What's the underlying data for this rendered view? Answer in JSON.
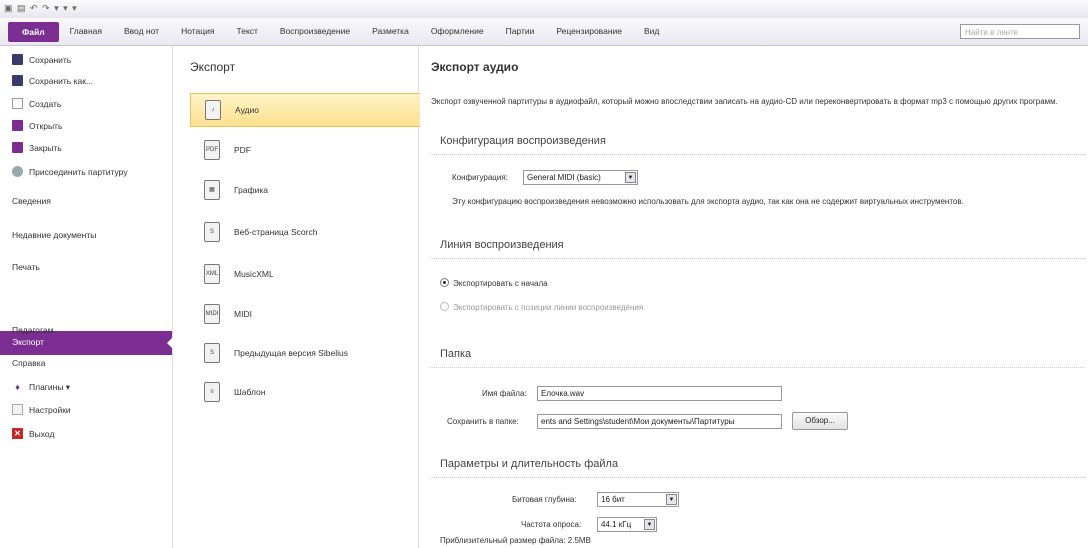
{
  "title_bar": {
    "quick_access": "▣ ▤ ↶ ↷ ▾ ▾ ▾"
  },
  "ribbon": {
    "tabs": [
      "Файл",
      "Главная",
      "Ввод нот",
      "Нотация",
      "Текст",
      "Воспроизведение",
      "Разметка",
      "Оформление",
      "Партии",
      "Рецензирование",
      "Вид"
    ],
    "search_placeholder": "Найти в ленте"
  },
  "sidebar": {
    "commands": [
      {
        "label": "Сохранить",
        "icon": "save-icon"
      },
      {
        "label": "Сохранить как...",
        "icon": "save-as-icon"
      },
      {
        "label": "Создать",
        "icon": "new-document-icon"
      },
      {
        "label": "Открыть",
        "icon": "open-folder-icon"
      },
      {
        "label": "Закрыть",
        "icon": "close-folder-icon"
      },
      {
        "label": "Присоединить партитуру",
        "icon": "attach-score-icon"
      }
    ],
    "sections": [
      "Сведения",
      "Недавние документы",
      "Печать",
      "Экспорт",
      "Педагогам",
      "Справка"
    ],
    "selected": "Экспорт",
    "bottom": [
      {
        "label": "Плагины ▾",
        "icon": "plugin-icon"
      },
      {
        "label": "Настройки",
        "icon": "settings-icon"
      },
      {
        "label": "Выход",
        "icon": "exit-icon"
      }
    ]
  },
  "export_panel": {
    "title": "Экспорт",
    "formats": [
      {
        "label": "Аудио",
        "icon_text": "♪"
      },
      {
        "label": "PDF",
        "icon_text": "PDF"
      },
      {
        "label": "Графика",
        "icon_text": "▦"
      },
      {
        "label": "Веб-страница Scorch",
        "icon_text": "S"
      },
      {
        "label": "MusicXML",
        "icon_text": "XML"
      },
      {
        "label": "MIDI",
        "icon_text": "MIDI"
      },
      {
        "label": "Предыдущая версия Sibelius",
        "icon_text": "S"
      },
      {
        "label": "Шаблон",
        "icon_text": "≡"
      }
    ]
  },
  "audio_export": {
    "title": "Экспорт аудио",
    "description": "Экспорт озвученной партитуры в аудиофайл, который можно впоследствии записать на аудио-CD или переконвертировать в формат mp3 с помощью других программ.",
    "playback_config": {
      "heading": "Конфигурация воспроизведения",
      "label": "Конфигурация:",
      "value": "General MIDI (basic)",
      "warning": "Эту конфигурацию воспроизведения невозможно использовать для экспорта аудио, так как она не содержит виртуальных инструментов."
    },
    "playback_line": {
      "heading": "Линия воспроизведения",
      "option1": "Экспортировать с начала",
      "option2": "Экспортировать с позиции линии воспроизведения"
    },
    "folder": {
      "heading": "Папка",
      "filename_label": "Имя файла:",
      "filename_value": "Елочка.wav",
      "save_label": "Сохранить в папке:",
      "save_value": "ents and Settings\\student\\Мои документы\\Партитуры",
      "browse": "Обзор..."
    },
    "params": {
      "heading": "Параметры и длительность файла",
      "bitdepth_label": "Битовая глубина:",
      "bitdepth_value": "16 бит",
      "rate_label": "Частота опроса:",
      "rate_value": "44.1 кГц",
      "size_label": "Приблизительный размер файла:",
      "size_value": "2.5MB"
    }
  }
}
